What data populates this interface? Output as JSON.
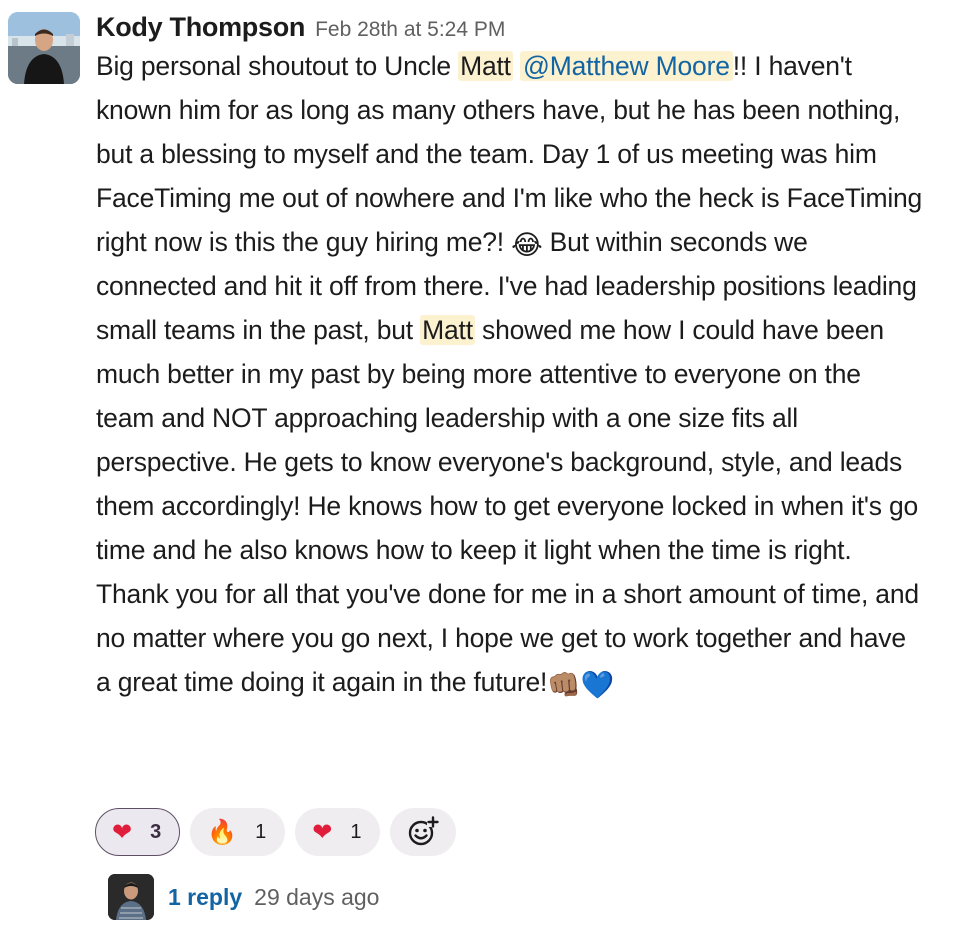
{
  "message": {
    "author": "Kody Thompson",
    "timestamp": "Feb 28th at 5:24 PM",
    "text_segments": {
      "s1": "Big personal shoutout to Uncle ",
      "highlight1": "Matt",
      "mention": "@Matthew Moore",
      "s2": "!! I haven't known him for as long as many others have, but he has been nothing, but a blessing to myself and the team. Day 1 of us meeting was him FaceTiming me out of nowhere and I'm like who the heck is FaceTiming right now is this the guy hiring me?! ",
      "emoji_laugh": "😂",
      "s3": " But within seconds we connected and hit it off from there. I've had leadership positions leading small teams in the past, but ",
      "highlight2": "Matt",
      "s4": " showed me how I could have been much better in my past by being more attentive to everyone on the team and NOT approaching leadership with a one size fits all perspective. He gets to know everyone's background, style, and leads them accordingly! He knows how to get everyone locked in when it's go time and he also knows how to keep it light when the time is right. Thank you for all that you've done for me in a short amount of time, and no matter where you go next, I hope we get to work together and have a great time doing it again in the future!",
      "emoji_fist": "👊🏽",
      "emoji_heart": "💙"
    },
    "avatar_icon": "user-avatar-photo"
  },
  "reactions": [
    {
      "emoji": "❤",
      "name": "heart",
      "count": "3",
      "active": true
    },
    {
      "emoji": "🔥",
      "name": "fire",
      "count": "1",
      "active": false
    },
    {
      "emoji": "❤",
      "name": "heart-2",
      "count": "1",
      "active": false
    }
  ],
  "add_reaction_icon": "add-emoji-icon",
  "thread": {
    "reply_label": "1 reply",
    "time_ago": "29 days ago"
  },
  "colors": {
    "link": "#1264a3",
    "highlight": "#fdf2d0",
    "text": "#1d1c1d",
    "muted": "#616061",
    "reaction_bg": "#efedf0",
    "reaction_active_border": "#5e5063"
  }
}
